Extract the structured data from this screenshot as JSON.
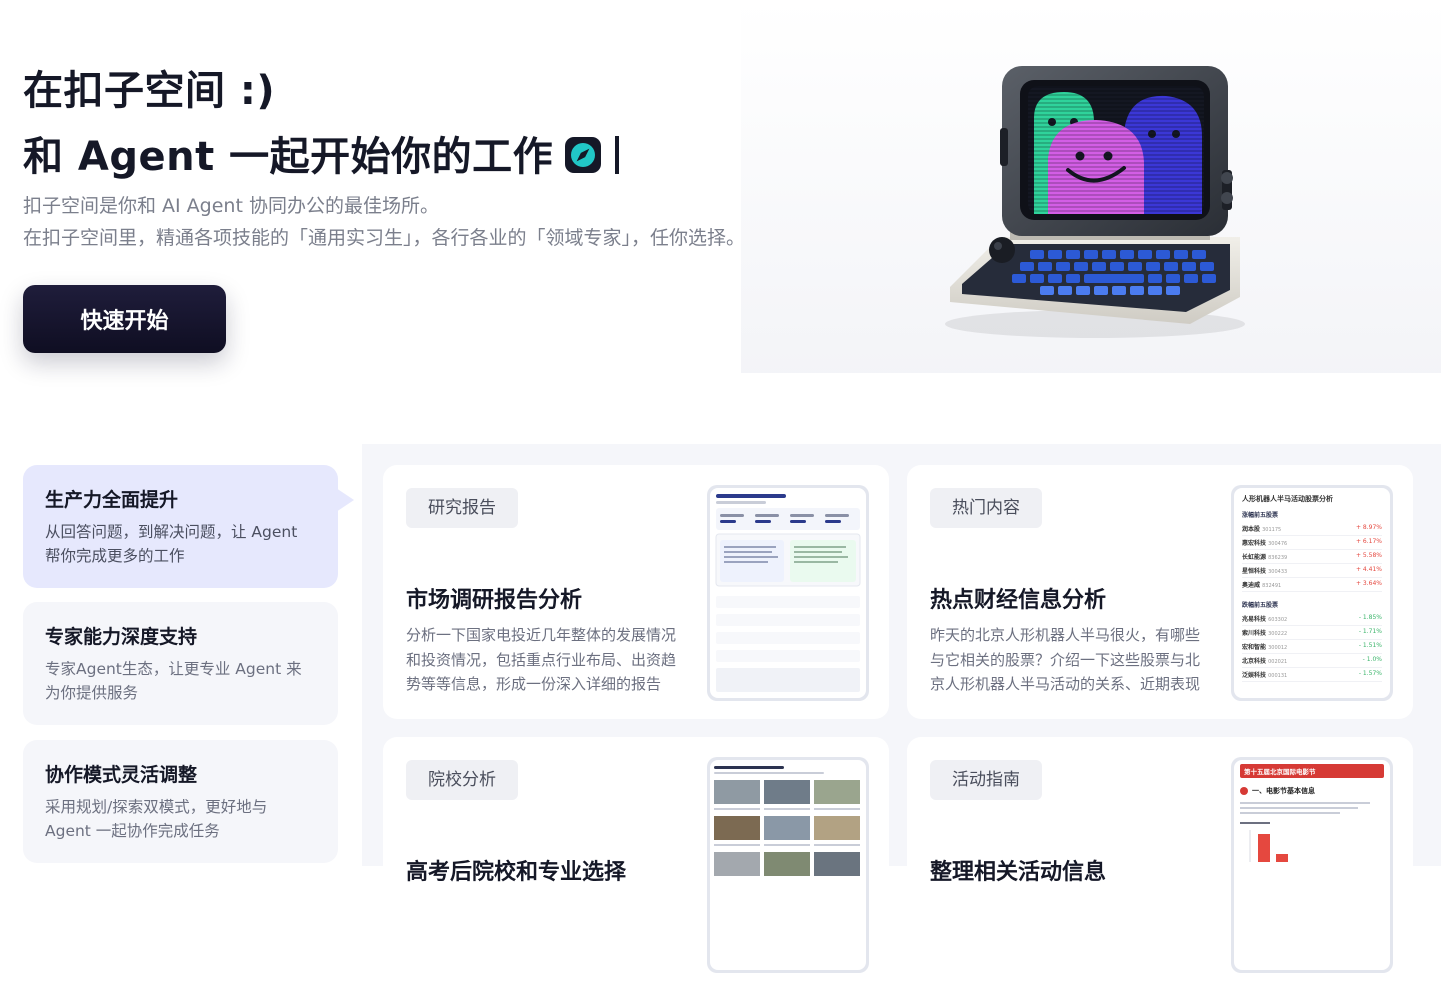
{
  "hero": {
    "title_line1": "在扣子空间 :)",
    "title_line2": "和 Agent 一起开始你的工作",
    "subtitle_line1": "扣子空间是你和 AI Agent 协同办公的最佳场所。",
    "subtitle_line2": "在扣子空间里，精通各项技能的「通用实习生」，各行各业的「领域专家」，任你选择。",
    "cta_label": "快速开始"
  },
  "features": [
    {
      "title": "生产力全面提升",
      "desc": "从回答问题，到解决问题，让 Agent 帮你完成更多的工作"
    },
    {
      "title": "专家能力深度支持",
      "desc": "专家Agent生态，让更专业 Agent 来为你提供服务"
    },
    {
      "title": "协作模式灵活调整",
      "desc": "采用规划/探索双模式，更好地与 Agent 一起协作完成任务"
    }
  ],
  "cards": [
    {
      "tag": "研究报告",
      "title": "市场调研报告分析",
      "desc": "分析一下国家电投近几年整体的发展情况和投资情况，包括重点行业布局、出资趋势等等信息，形成一份深入详细的报告"
    },
    {
      "tag": "热门内容",
      "title": "热点财经信息分析",
      "desc": "昨天的北京人形机器人半马很火，有哪些与它相关的股票？介绍一下这些股票与北京人形机器人半马活动的关系、近期表现"
    },
    {
      "tag": "院校分析",
      "title": "高考后院校和专业选择",
      "desc": ""
    },
    {
      "tag": "活动指南",
      "title": "整理相关活动信息",
      "desc": ""
    }
  ],
  "thumb_stock": {
    "title": "人形机器人半马活动股票分析",
    "up_title": "涨幅前五股票",
    "down_title": "跌幅前五股票",
    "up": [
      {
        "name": "润本股",
        "code": "301175",
        "pct": "+ 8.97%"
      },
      {
        "name": "惠宏科技",
        "code": "300476",
        "pct": "+ 6.17%"
      },
      {
        "name": "长虹能源",
        "code": "836239",
        "pct": "+ 5.58%"
      },
      {
        "name": "星恒科技",
        "code": "300433",
        "pct": "+ 4.41%"
      },
      {
        "name": "奥迪威",
        "code": "832491",
        "pct": "+ 3.64%"
      }
    ],
    "down": [
      {
        "name": "兆易科技",
        "code": "603302",
        "pct": "- 1.85%"
      },
      {
        "name": "索川科技",
        "code": "300222",
        "pct": "- 1.71%"
      },
      {
        "name": "宏和智能",
        "code": "300012",
        "pct": "- 1.51%"
      },
      {
        "name": "北京科技",
        "code": "002021",
        "pct": "- 1.0%"
      },
      {
        "name": "泛娱科技",
        "code": "000131",
        "pct": "- 1.57%"
      }
    ]
  },
  "thumb_film": {
    "banner": "第十五届北京国际电影节",
    "section": "一、电影节基本信息"
  },
  "colors": {
    "accent": "#e6e8fd",
    "cta": "#15142e",
    "up": "#e5483f",
    "down": "#3cb56b"
  }
}
